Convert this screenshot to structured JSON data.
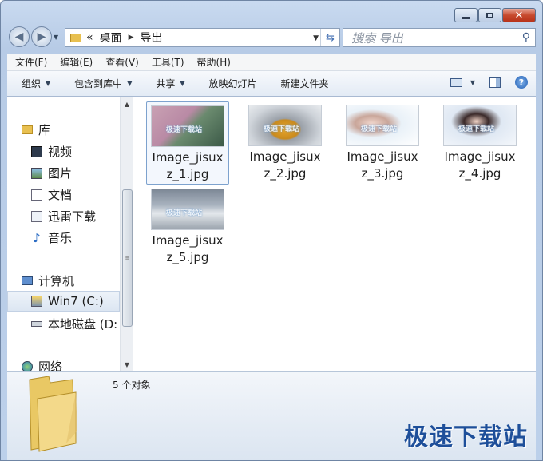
{
  "window": {
    "caption_buttons": [
      "minimize",
      "maximize",
      "close"
    ]
  },
  "address": {
    "prefix": "«",
    "crumbs": [
      "桌面",
      "导出"
    ],
    "refresh_icon": "refresh-icon"
  },
  "search": {
    "placeholder": "搜索 导出"
  },
  "menu": [
    "文件(F)",
    "编辑(E)",
    "查看(V)",
    "工具(T)",
    "帮助(H)"
  ],
  "toolbar": {
    "organize": "组织",
    "include_library": "包含到库中",
    "share": "共享",
    "slideshow": "放映幻灯片",
    "new_folder": "新建文件夹"
  },
  "nav": {
    "libraries": "库",
    "videos": "视频",
    "pictures": "图片",
    "documents": "文档",
    "xunlei": "迅雷下载",
    "music": "音乐",
    "computer": "计算机",
    "win7": "Win7 (C:)",
    "local_disk": "本地磁盘 (D:",
    "network": "网络"
  },
  "files": [
    {
      "name_line1": "Image_jisux",
      "name_line2": "z_1.jpg"
    },
    {
      "name_line1": "Image_jisux",
      "name_line2": "z_2.jpg"
    },
    {
      "name_line1": "Image_jisux",
      "name_line2": "z_3.jpg"
    },
    {
      "name_line1": "Image_jisux",
      "name_line2": "z_4.jpg"
    },
    {
      "name_line1": "Image_jisux",
      "name_line2": "z_5.jpg"
    }
  ],
  "watermark": "极速下载站",
  "status": {
    "count": "5 个对象"
  },
  "brand": "极速下载站",
  "colors": {
    "window_frame": "#bcd0ea",
    "selection": "#7da2ce",
    "brand": "#1e4f9a"
  }
}
